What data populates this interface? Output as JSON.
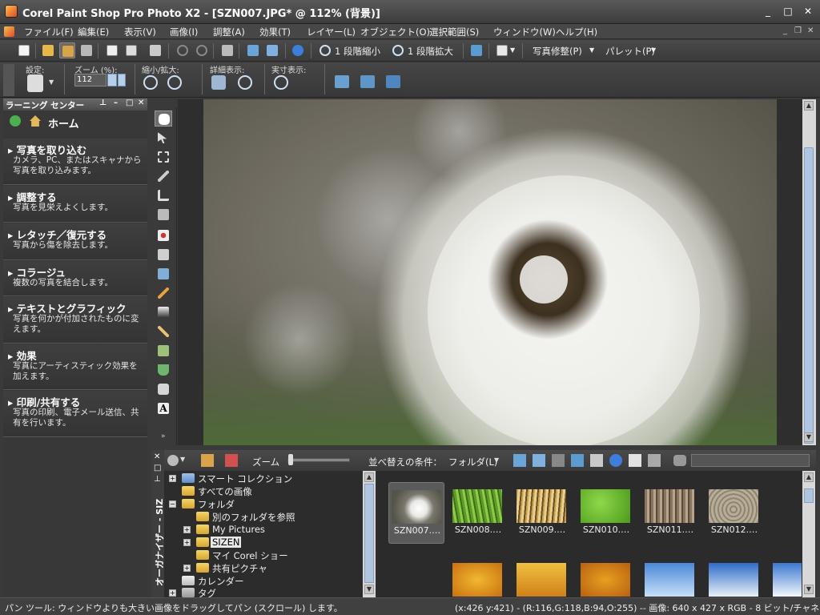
{
  "window": {
    "title": "Corel Paint Shop Pro Photo X2 - [SZN007.JPG* @ 112% (背景)]",
    "minimize": "_",
    "maximize": "□",
    "close": "✕"
  },
  "menu": {
    "items": [
      "ファイル(F)",
      "編集(E)",
      "表示(V)",
      "画像(I)",
      "調整(A)",
      "効果(T)",
      "レイヤー(L)",
      "オブジェクト(O)",
      "選択範囲(S)",
      "ウィンドウ(W)",
      "ヘルプ(H)"
    ],
    "mdi_min": "_",
    "mdi_restore": "❐",
    "mdi_close": "✕"
  },
  "toolbar": {
    "zoom_out_label": "1 段階縮小",
    "zoom_in_label": "1 段階拡大",
    "photo_fix_label": "写真修整(P)",
    "palette_label": "パレット(P)"
  },
  "tool_options": {
    "settings_label": "設定:",
    "zoom_label": "ズーム (%):",
    "zoom_value": "112",
    "zoom_out_in_label": "縮小/拡大:",
    "detail_label": "詳細表示:",
    "actual_label": "実寸表示:"
  },
  "learning_center": {
    "title": "ラーニング センター",
    "home_label": "ホーム",
    "sections": [
      {
        "title": "写真を取り込む",
        "desc": "カメラ、PC、またはスキャナから写真を取り込みます。"
      },
      {
        "title": "調整する",
        "desc": "写真を見栄えよくします。"
      },
      {
        "title": "レタッチ／復元する",
        "desc": "写真から傷を除去します。"
      },
      {
        "title": "コラージュ",
        "desc": "複数の写真を結合します。"
      },
      {
        "title": "テキストとグラフィック",
        "desc": "写真を何かが付加されたものに変えます。"
      },
      {
        "title": "効果",
        "desc": "写真にアーティスティック効果を加えます。"
      },
      {
        "title": "印刷/共有する",
        "desc": "写真の印刷、電子メール送信、共有を行います。"
      }
    ]
  },
  "organizer": {
    "side_label": "オーガナイザー - SIZ",
    "zoom_label": "ズーム",
    "sort_label": "並べ替えの条件：",
    "sort_value": "フォルダ(L)",
    "tree": [
      "スマート コレクション",
      "すべての画像",
      "フォルダ",
      "別のフォルダを参照",
      "My Pictures",
      "SIZEN",
      "マイ Corel ショー",
      "共有ピクチャ",
      "カレンダー",
      "タグ"
    ],
    "thumbnails": [
      "SZN007.…",
      "SZN008.…",
      "SZN009.…",
      "SZN010.…",
      "SZN011.…",
      "SZN012.…"
    ]
  },
  "status": {
    "hint": "パン ツール: ウィンドウよりも大きい画像をドラッグしてパン (スクロール) します。",
    "info": "(x:426 y:421) - (R:116,G:118,B:94,O:255) -- 画像:  640 x 427 x RGB - 8 ビット/チャネル"
  }
}
